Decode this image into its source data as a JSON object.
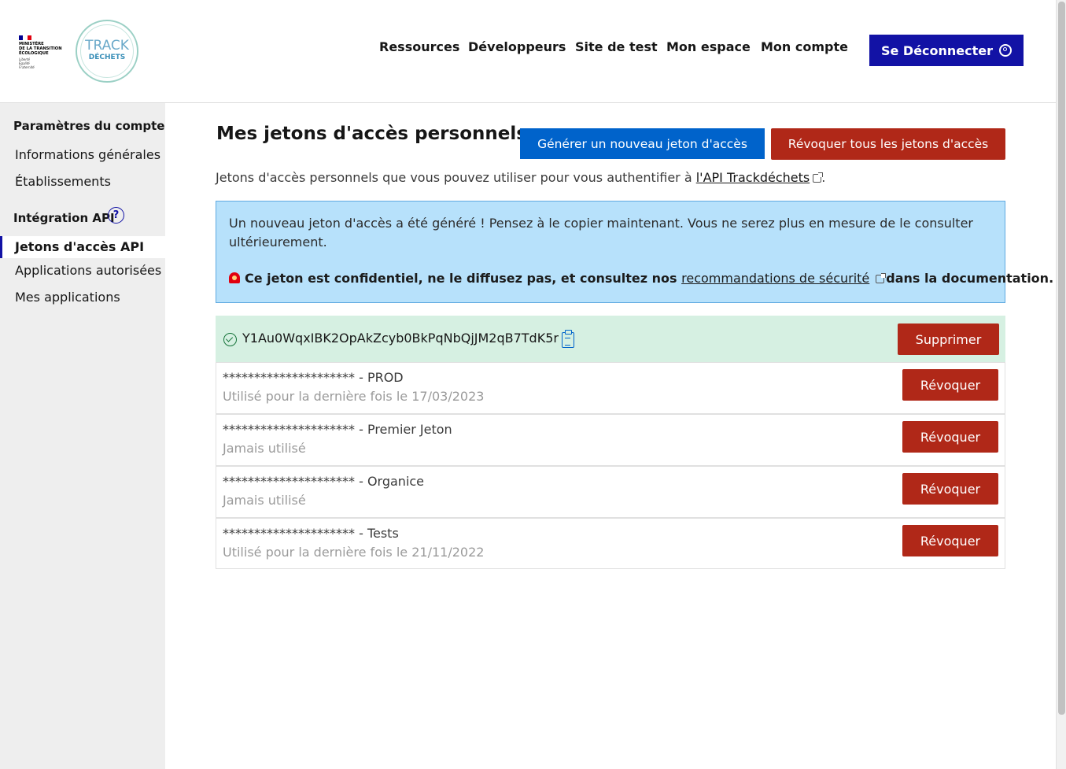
{
  "header": {
    "ministry_lines": [
      "Ministère",
      "de la transition",
      "écologique"
    ],
    "ministry_devise": [
      "Liberté",
      "Égalité",
      "Fraternité"
    ],
    "brand_line1": "TRACK",
    "brand_line2": "DÉCHETS",
    "nav": [
      "Ressources",
      "Développeurs",
      "Site de test",
      "Mon espace",
      "Mon compte"
    ],
    "logout_label": "Se Déconnecter"
  },
  "sidebar": {
    "section1_title": "Paramètres du compte",
    "section1_items": [
      "Informations générales",
      "Établissements"
    ],
    "section2_title": "Intégration API",
    "help_icon_glyph": "?",
    "active_item": "Jetons d'accès API",
    "section2_items": [
      "Applications autorisées",
      "Mes applications"
    ]
  },
  "main": {
    "title": "Mes jetons d'accès personnels",
    "generate_label": "Générer un nouveau jeton d'accès",
    "revoke_all_label": "Révoquer tous les jetons d'accès",
    "description_prefix": "Jetons d'accès personnels que vous pouvez utiliser pour vous authentifier à ",
    "description_link": "l'API Trackdéchets",
    "description_suffix": ".",
    "alert": {
      "text": "Un nouveau jeton d'accès a été généré ! Pensez à le copier maintenant. Vous ne serez plus en mesure de le consulter ultérieurement.",
      "warning_prefix": "Ce jeton est confidentiel, ne le diffusez pas, et consultez nos ",
      "warning_link": "recommandations de sécurité",
      "warning_suffix": "dans la documentation."
    },
    "new_token": {
      "value": "Y1Au0WqxIBK2OpAkZcyb0BkPqNbQjJM2qB7TdK5r",
      "delete_label": "Supprimer"
    },
    "tokens": [
      {
        "name": "********************* - PROD",
        "usage": "Utilisé pour la dernière fois le 17/03/2023",
        "action": "Révoquer"
      },
      {
        "name": "********************* - Premier Jeton",
        "usage": "Jamais utilisé",
        "action": "Révoquer"
      },
      {
        "name": "********************* - Organice",
        "usage": "Jamais utilisé",
        "action": "Révoquer"
      },
      {
        "name": "********************* - Tests",
        "usage": "Utilisé pour la dernière fois le 21/11/2022",
        "action": "Révoquer"
      }
    ]
  },
  "colors": {
    "primary": "#1212a5",
    "info": "#0063cb",
    "danger": "#b02818",
    "success_bg": "#d6f0e2",
    "alert_bg": "#b7e1fb"
  }
}
